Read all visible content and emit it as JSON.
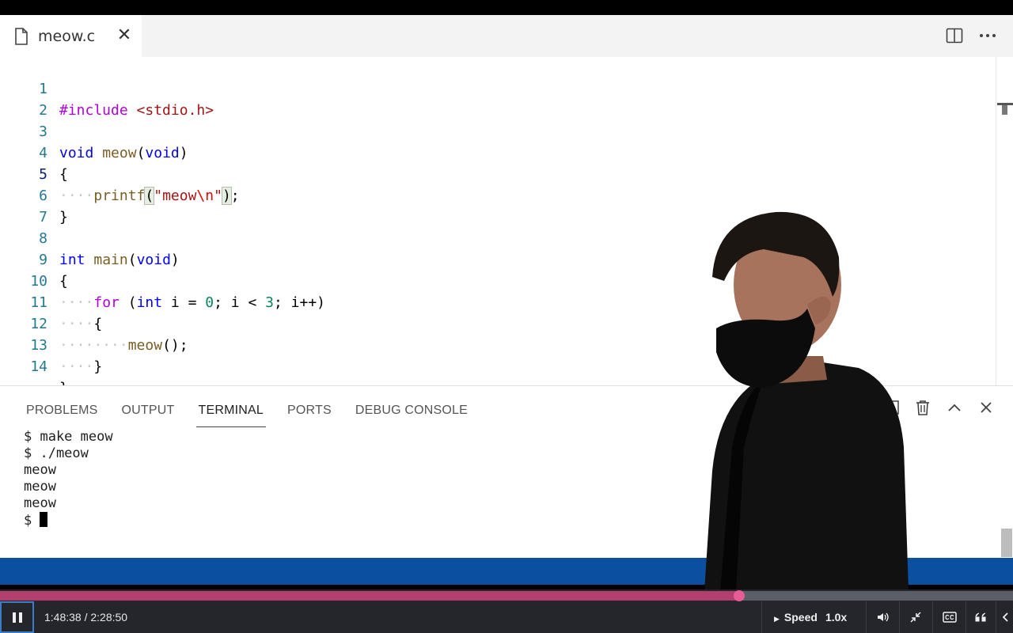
{
  "editor": {
    "tab": {
      "filename": "meow.c",
      "close_glyph": "✕"
    },
    "lines": [
      {
        "n": "1"
      },
      {
        "n": "2"
      },
      {
        "n": "3"
      },
      {
        "n": "4"
      },
      {
        "n": "5"
      },
      {
        "n": "6"
      },
      {
        "n": "7"
      },
      {
        "n": "8"
      },
      {
        "n": "9"
      },
      {
        "n": "10"
      },
      {
        "n": "11"
      },
      {
        "n": "12"
      },
      {
        "n": "13"
      },
      {
        "n": "14"
      }
    ],
    "code": {
      "l1_directive": "#include",
      "l1_header": "<stdio.h>",
      "l3_type": "void",
      "l3_name": "meow",
      "l3_param": "void",
      "brace_open": "{",
      "brace_close": "}",
      "l5_call": "printf",
      "l5_str_a": "\"meow",
      "l5_esc": "\\n",
      "l5_str_b": "\"",
      "l8_type": "int",
      "l8_name": "main",
      "l8_param": "void",
      "l10_kw": "for",
      "l10_type": "int",
      "l10_init": "i = ",
      "l10_zero": "0",
      "l10_cond": "; i < ",
      "l10_three": "3",
      "l10_inc": "; i++)",
      "l12_call": "meow",
      "l12_rest": "();"
    },
    "whitespace": {
      "four": "····",
      "eight": "········"
    }
  },
  "panel": {
    "tabs": [
      {
        "label": "PROBLEMS"
      },
      {
        "label": "OUTPUT"
      },
      {
        "label": "TERMINAL"
      },
      {
        "label": "PORTS"
      },
      {
        "label": "DEBUG CONSOLE"
      }
    ],
    "active_tab": "TERMINAL",
    "terminal_lines": [
      "$ make meow",
      "$ ./meow",
      "meow",
      "meow",
      "meow"
    ],
    "prompt": "$ "
  },
  "player": {
    "time_current": "1:48:38",
    "time_total": "2:28:50",
    "time_display": "1:48:38 / 2:28:50",
    "progress_fraction": 0.73,
    "speed_label": "Speed",
    "speed_value": "1.0x"
  },
  "colors": {
    "statusbar": "#0a4fa0",
    "progress": "#b23f6e",
    "progress_knob": "#e85c95"
  }
}
